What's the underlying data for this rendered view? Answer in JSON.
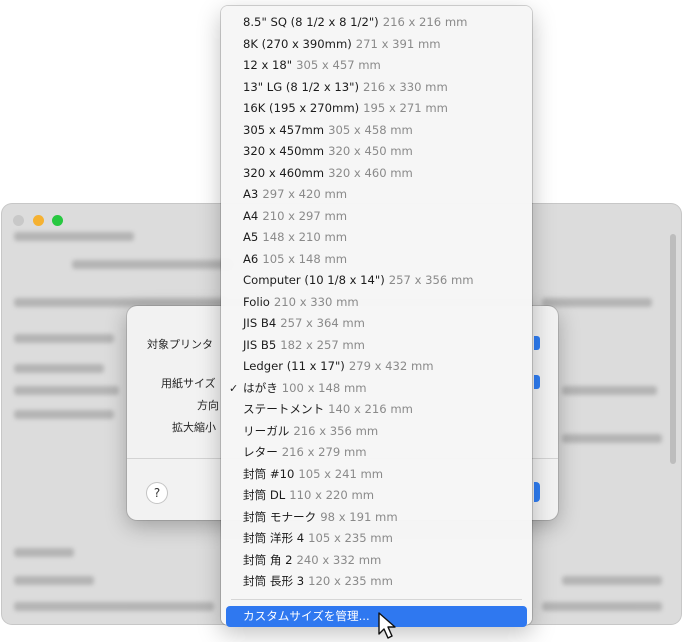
{
  "dialog": {
    "printer_label": "対象プリンタ",
    "paper_size_label": "用紙サイズ",
    "orientation_label": "方向",
    "scale_label": "拡大縮小",
    "help_label": "?"
  },
  "paper_menu": {
    "selected": "はがき",
    "items": [
      {
        "name": "8.5\" SQ (8 1/2 x 8 1/2\")",
        "dims": "216 x 216 mm"
      },
      {
        "name": "8K (270 x 390mm)",
        "dims": "271 x 391 mm"
      },
      {
        "name": "12 x 18\"",
        "dims": "305 x 457 mm"
      },
      {
        "name": "13\" LG (8 1/2 x 13\")",
        "dims": "216 x 330 mm"
      },
      {
        "name": "16K (195 x 270mm)",
        "dims": "195 x 271 mm"
      },
      {
        "name": "305 x 457mm",
        "dims": "305 x 458 mm"
      },
      {
        "name": "320 x 450mm",
        "dims": "320 x 450 mm"
      },
      {
        "name": "320 x 460mm",
        "dims": "320 x 460 mm"
      },
      {
        "name": "A3",
        "dims": "297 x 420 mm"
      },
      {
        "name": "A4",
        "dims": "210 x 297 mm"
      },
      {
        "name": "A5",
        "dims": "148 x 210 mm"
      },
      {
        "name": "A6",
        "dims": "105 x 148 mm"
      },
      {
        "name": "Computer (10 1/8 x 14\")",
        "dims": "257 x 356 mm"
      },
      {
        "name": "Folio",
        "dims": "210 x 330 mm"
      },
      {
        "name": "JIS B4",
        "dims": "257 x 364 mm"
      },
      {
        "name": "JIS B5",
        "dims": "182 x 257 mm"
      },
      {
        "name": "Ledger (11 x 17\")",
        "dims": "279 x 432 mm"
      },
      {
        "name": "はがき",
        "dims": "100 x 148 mm",
        "checked": "✓"
      },
      {
        "name": "ステートメント",
        "dims": "140 x 216 mm"
      },
      {
        "name": "リーガル",
        "dims": "216 x 356 mm"
      },
      {
        "name": "レター",
        "dims": "216 x 279 mm"
      },
      {
        "name": "封筒 #10",
        "dims": "105 x 241 mm"
      },
      {
        "name": "封筒 DL",
        "dims": "110 x 220 mm"
      },
      {
        "name": "封筒 モナーク",
        "dims": "98 x 191 mm"
      },
      {
        "name": "封筒 洋形 4",
        "dims": "105 x 235 mm"
      },
      {
        "name": "封筒 角 2",
        "dims": "240 x 332 mm"
      },
      {
        "name": "封筒 長形 3",
        "dims": "120 x 235 mm"
      }
    ],
    "manage_custom_label": "カスタムサイズを管理..."
  },
  "icons": {
    "check": "check-icon",
    "cursor": "mouse-pointer-icon",
    "help": "question-icon"
  },
  "colors": {
    "highlight": "#2f78f0",
    "accent": "#2f7ef5",
    "traffic_min": "#f5b131",
    "traffic_zoom": "#27c840"
  }
}
